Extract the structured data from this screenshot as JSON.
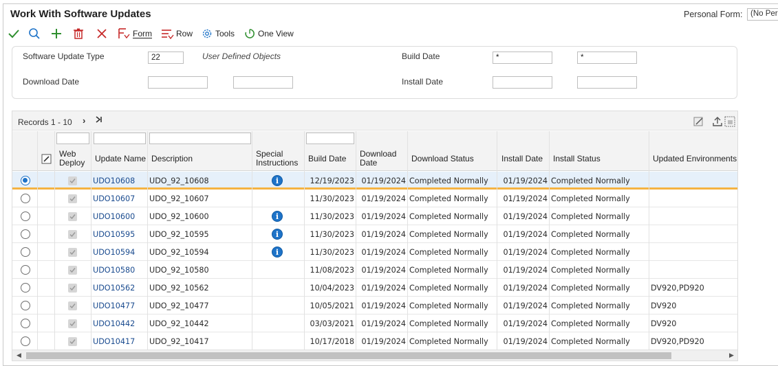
{
  "title": "Work With Software Updates",
  "personal_form": {
    "label": "Personal Form:",
    "value": "(No Personal Form)"
  },
  "toolbar": {
    "form_label": "Form",
    "row_label": "Row",
    "tools_label": "Tools",
    "oneview_label": "One View"
  },
  "filters": {
    "software_update_type_label": "Software Update Type",
    "software_update_type_value": "22",
    "software_update_type_desc": "User Defined Objects",
    "build_date_label": "Build Date",
    "build_date_from": "*",
    "build_date_to": "*",
    "download_date_label": "Download Date",
    "download_date_from": "",
    "download_date_to": "",
    "install_date_label": "Install Date",
    "install_date_from": "",
    "install_date_to": ""
  },
  "grid": {
    "records_label": "Records 1 - 10",
    "headers": {
      "web_deploy": "Web Deploy",
      "update_name": "Update Name",
      "description": "Description",
      "special_instructions": "Special Instructions",
      "build_date": "Build Date",
      "download_date": "Download Date",
      "download_status": "Download Status",
      "install_date": "Install Date",
      "install_status": "Install Status",
      "updated_environments": "Updated Environments"
    },
    "rows": [
      {
        "selected": true,
        "name": "UDO10608",
        "desc": "UDO_92_10608",
        "info": true,
        "build": "12/19/2023",
        "download": "01/19/2024",
        "dstatus": "Completed Normally",
        "install": "01/19/2024",
        "istatus": "Completed Normally",
        "env": ""
      },
      {
        "selected": false,
        "name": "UDO10607",
        "desc": "UDO_92_10607",
        "info": false,
        "build": "11/30/2023",
        "download": "01/19/2024",
        "dstatus": "Completed Normally",
        "install": "01/19/2024",
        "istatus": "Completed Normally",
        "env": ""
      },
      {
        "selected": false,
        "name": "UDO10600",
        "desc": "UDO_92_10600",
        "info": true,
        "build": "11/30/2023",
        "download": "01/19/2024",
        "dstatus": "Completed Normally",
        "install": "01/19/2024",
        "istatus": "Completed Normally",
        "env": ""
      },
      {
        "selected": false,
        "name": "UDO10595",
        "desc": "UDO_92_10595",
        "info": true,
        "build": "11/30/2023",
        "download": "01/19/2024",
        "dstatus": "Completed Normally",
        "install": "01/19/2024",
        "istatus": "Completed Normally",
        "env": ""
      },
      {
        "selected": false,
        "name": "UDO10594",
        "desc": "UDO_92_10594",
        "info": true,
        "build": "11/30/2023",
        "download": "01/19/2024",
        "dstatus": "Completed Normally",
        "install": "01/19/2024",
        "istatus": "Completed Normally",
        "env": ""
      },
      {
        "selected": false,
        "name": "UDO10580",
        "desc": "UDO_92_10580",
        "info": false,
        "build": "11/08/2023",
        "download": "01/19/2024",
        "dstatus": "Completed Normally",
        "install": "01/19/2024",
        "istatus": "Completed Normally",
        "env": ""
      },
      {
        "selected": false,
        "name": "UDO10562",
        "desc": "UDO_92_10562",
        "info": false,
        "build": "10/04/2023",
        "download": "01/19/2024",
        "dstatus": "Completed Normally",
        "install": "01/19/2024",
        "istatus": "Completed Normally",
        "env": "DV920,PD920"
      },
      {
        "selected": false,
        "name": "UDO10477",
        "desc": "UDO_92_10477",
        "info": false,
        "build": "10/05/2021",
        "download": "01/19/2024",
        "dstatus": "Completed Normally",
        "install": "01/19/2024",
        "istatus": "Completed Normally",
        "env": "DV920"
      },
      {
        "selected": false,
        "name": "UDO10442",
        "desc": "UDO_92_10442",
        "info": false,
        "build": "03/03/2021",
        "download": "01/19/2024",
        "dstatus": "Completed Normally",
        "install": "01/19/2024",
        "istatus": "Completed Normally",
        "env": "DV920"
      },
      {
        "selected": false,
        "name": "UDO10417",
        "desc": "UDO_92_10417",
        "info": false,
        "build": "10/17/2018",
        "download": "01/19/2024",
        "dstatus": "Completed Normally",
        "install": "01/19/2024",
        "istatus": "Completed Normally",
        "env": "DV920,PD920"
      }
    ]
  },
  "colors": {
    "accent": "#1e73c8",
    "link": "#1a4b8f",
    "selected_row": "#e6f0fa",
    "selected_underline": "#f5b342",
    "ok_green": "#2f8f2f",
    "delete_red": "#c62828"
  }
}
